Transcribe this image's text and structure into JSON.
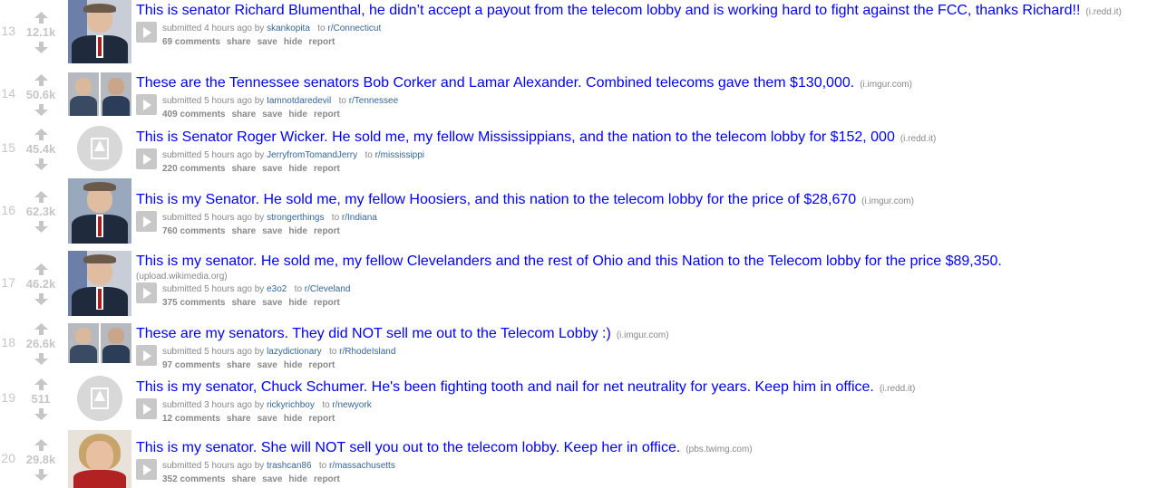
{
  "posts": [
    {
      "rank": "13",
      "score": "12.1k",
      "title": "This is senator Richard Blumenthal, he didn’t accept a payout from the telecom lobby and is working hard to fight against the FCC, thanks Richard!!",
      "domain": "(i.redd.it)",
      "time": "submitted 4 hours ago by",
      "user": "skankopita",
      "to": "to",
      "sub": "r/Connecticut",
      "comments": "69 comments",
      "share": "share",
      "save": "save",
      "hide": "hide",
      "report": "report",
      "thumb": "photo-flag"
    },
    {
      "rank": "14",
      "score": "50.6k",
      "title": "These are the Tennessee senators Bob Corker and Lamar Alexander. Combined telecoms gave them $130,000.",
      "domain": "(i.imgur.com)",
      "time": "submitted 5 hours ago by",
      "user": "Iamnotdaredevil",
      "to": "to",
      "sub": "r/Tennessee",
      "comments": "409 comments",
      "share": "share",
      "save": "save",
      "hide": "hide",
      "report": "report",
      "thumb": "photo-pair"
    },
    {
      "rank": "15",
      "score": "45.4k",
      "title": "This is Senator Roger Wicker. He sold me, my fellow Mississippians, and the nation to the telecom lobby for $152, 000",
      "domain": "(i.redd.it)",
      "time": "submitted 5 hours ago by",
      "user": "JerryfromTomandJerry",
      "to": "to",
      "sub": "r/mississippi",
      "comments": "220 comments",
      "share": "share",
      "save": "save",
      "hide": "hide",
      "report": "report",
      "thumb": "placeholder"
    },
    {
      "rank": "16",
      "score": "62.3k",
      "title": "This is my Senator. He sold me, my fellow Hoosiers, and this nation to the telecom lobby for the price of $28,670",
      "domain": "(i.imgur.com)",
      "time": "submitted 5 hours ago by",
      "user": "strongerthings",
      "to": "to",
      "sub": "r/Indiana",
      "comments": "760 comments",
      "share": "share",
      "save": "save",
      "hide": "hide",
      "report": "report",
      "thumb": "photo"
    },
    {
      "rank": "17",
      "score": "46.2k",
      "title": "This is my senator. He sold me, my fellow Clevelanders and the rest of Ohio and this Nation to the Telecom lobby for the price $89,350.",
      "domain": "(upload.wikimedia.org)",
      "time": "submitted 5 hours ago by",
      "user": "e3o2",
      "to": "to",
      "sub": "r/Cleveland",
      "comments": "375 comments",
      "share": "share",
      "save": "save",
      "hide": "hide",
      "report": "report",
      "thumb": "photo-flag"
    },
    {
      "rank": "18",
      "score": "26.6k",
      "title": "These are my senators. They did NOT sell me out to the Telecom Lobby :)",
      "domain": "(i.imgur.com)",
      "time": "submitted 5 hours ago by",
      "user": "lazydictionary",
      "to": "to",
      "sub": "r/RhodeIsland",
      "comments": "97 comments",
      "share": "share",
      "save": "save",
      "hide": "hide",
      "report": "report",
      "thumb": "photo-pair"
    },
    {
      "rank": "19",
      "score": "511",
      "title": "This is my senator, Chuck Schumer. He's been fighting tooth and nail for net neutrality for years. Keep him in office.",
      "domain": "(i.redd.it)",
      "time": "submitted 3 hours ago by",
      "user": "rickyrichboy",
      "to": "to",
      "sub": "r/newyork",
      "comments": "12 comments",
      "share": "share",
      "save": "save",
      "hide": "hide",
      "report": "report",
      "thumb": "placeholder"
    },
    {
      "rank": "20",
      "score": "29.8k",
      "title": "This is my senator. She will NOT sell you out to the telecom lobby. Keep her in office.",
      "domain": "(pbs.twimg.com)",
      "time": "submitted 5 hours ago by",
      "user": "trashcan86",
      "to": "to",
      "sub": "r/massachusetts",
      "comments": "352 comments",
      "share": "share",
      "save": "save",
      "hide": "hide",
      "report": "report",
      "thumb": "photo-woman"
    }
  ],
  "colors": {
    "title": "#0000ff",
    "score": "#c6c6c6",
    "meta": "#888888",
    "link": "#336699",
    "arrow": "#c6c6c6"
  }
}
